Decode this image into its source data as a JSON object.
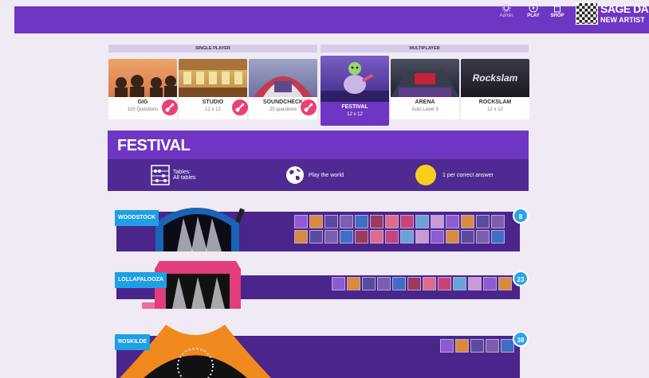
{
  "nav": {
    "admin_label": "Admin",
    "play_label": "PLAY",
    "shop_label": "SHOP",
    "profile_name": "SAGE DA",
    "profile_sub": "NEW ARTIST"
  },
  "modes": {
    "single_label": "SINGLE PLAYER",
    "multi_label": "MULTIPLAYER",
    "items": [
      {
        "title": "GIG",
        "subtitle": "100 Questions"
      },
      {
        "title": "STUDIO",
        "subtitle": "12 x 12"
      },
      {
        "title": "SOUNDCHECK",
        "subtitle": "25 questions"
      },
      {
        "title": "FESTIVAL",
        "subtitle": "12 x 12"
      },
      {
        "title": "ARENA",
        "subtitle": "Auto Level 3"
      },
      {
        "title": "ROCKSLAM",
        "subtitle": "12 x 12"
      }
    ],
    "arena_sign": "Rockslam"
  },
  "festival": {
    "title": "FESTIVAL",
    "tables_label": "Tables:",
    "tables_value": "All tables",
    "world_label": "Play the world",
    "coin_label": "1 per correct answer",
    "rows": [
      {
        "name": "WOODSTOCK",
        "count": "8"
      },
      {
        "name": "LOLLAPALOOZA",
        "count": "23"
      },
      {
        "name": "ROSKILDE",
        "count": "38"
      }
    ]
  },
  "colors": {
    "brand_purple": "#6e36c2",
    "dark_purple": "#4a258c",
    "badge_blue": "#2ba3ec",
    "edit_pink": "#ec3f72",
    "coin_yellow": "#f6cf1e"
  }
}
